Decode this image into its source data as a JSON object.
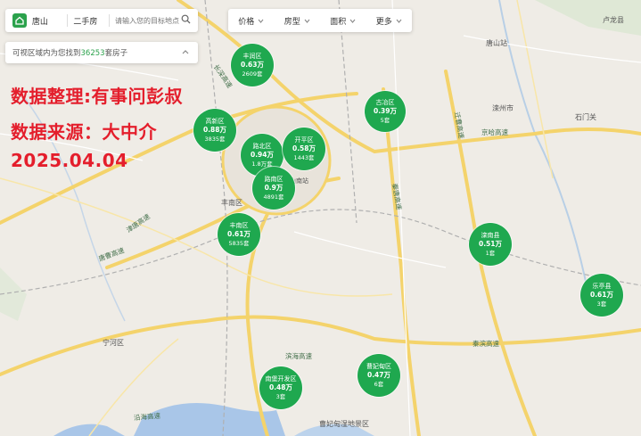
{
  "search": {
    "city": "唐山",
    "type": "二手房",
    "placeholder": "请输入您的目标地点"
  },
  "summary": {
    "prefix": "可视区域内为您找到",
    "count": "36253",
    "suffix": "套房子"
  },
  "filters": [
    "价格",
    "房型",
    "面积",
    "更多"
  ],
  "overlay": {
    "line1": "数据整理:有事问彭叔",
    "line2": "数据来源：大中介",
    "line3": "2025.04.04"
  },
  "districts": [
    {
      "name": "丰润区",
      "price": "0.63万",
      "count": "2609套"
    },
    {
      "name": "古冶区",
      "price": "0.39万",
      "count": "5套"
    },
    {
      "name": "高新区",
      "price": "0.88万",
      "count": "3835套"
    },
    {
      "name": "路北区",
      "price": "0.94万",
      "count": "1.8万套"
    },
    {
      "name": "开平区",
      "price": "0.58万",
      "count": "1443套"
    },
    {
      "name": "路南区",
      "price": "0.9万",
      "count": "4891套"
    },
    {
      "name": "丰南区",
      "price": "0.61万",
      "count": "5835套"
    },
    {
      "name": "滦南县",
      "price": "0.51万",
      "count": "1套"
    },
    {
      "name": "乐亭县",
      "price": "0.61万",
      "count": "3套"
    },
    {
      "name": "南堡开发区",
      "price": "0.48万",
      "count": "3套"
    },
    {
      "name": "曹妃甸区",
      "price": "0.47万",
      "count": "6套"
    }
  ],
  "map_labels": {
    "town1": "丰南区",
    "town2": "宁河区",
    "town3": "滦州市",
    "town4": "卢龙县",
    "station": "唐山站",
    "tang_south": "唐山南站",
    "wetland": "曹妃甸湿地景区",
    "shitang": "石门关"
  },
  "road_labels": {
    "r1": "唐曹高速",
    "r2": "津唐高速",
    "r3": "滨海高速",
    "r4": "秦唐高速",
    "r5": "迁曹高速",
    "r6": "秦滨高速",
    "r7": "沿海高速",
    "r8": "京哈高速",
    "r9": "长深高速"
  },
  "colors": {
    "bubble": "#1fa84f",
    "accent": "#2ba24c",
    "overlay_text": "#e41e2c",
    "water": "#a9c6e8",
    "highway": "#f4d36b"
  }
}
